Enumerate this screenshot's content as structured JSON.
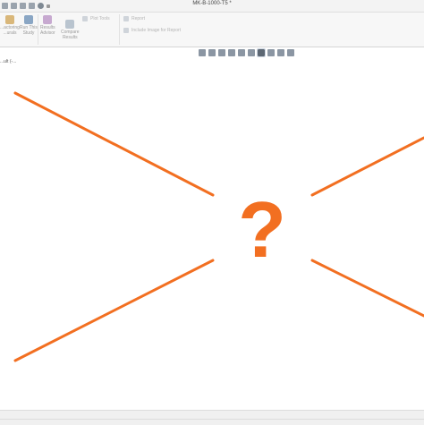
{
  "window": {
    "title": "MK-B-1000-T5 *"
  },
  "ribbon": {
    "buttons": [
      {
        "label_1": "...actoring",
        "label_2": "...urals"
      },
      {
        "label_1": "Run This",
        "label_2": "Study"
      },
      {
        "label_1": "Results",
        "label_2": "Advisor"
      },
      {
        "label_1": "Compare",
        "label_2": "Results"
      }
    ],
    "plot_tools": "Plot Tools",
    "report": "Report",
    "include_image": "Include Image for Report"
  },
  "tree": {
    "item_label": "...ult (-..."
  },
  "placeholder": {
    "glyph": "?",
    "color": "#f26f21"
  },
  "colors": {
    "accent": "#f26f21"
  }
}
